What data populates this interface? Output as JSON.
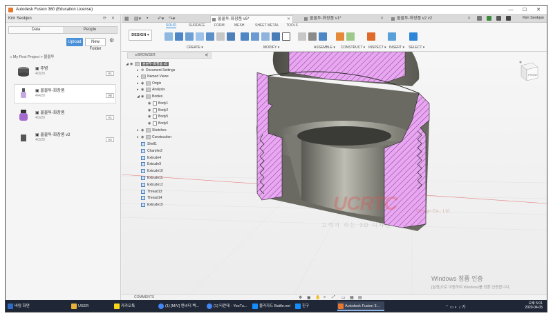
{
  "window": {
    "title": "Autodesk Fusion 360 (Education License)",
    "controls": [
      "—",
      "☐",
      "✕"
    ]
  },
  "data_panel": {
    "user": "Kim Seokjun",
    "tabs": [
      {
        "label": "Data",
        "active": true
      },
      {
        "label": "People",
        "active": false
      }
    ],
    "upload_label": "Upload",
    "new_folder_label": "New Folder",
    "breadcrumb": "My First Project  >  물물투",
    "files": [
      {
        "name": "주병",
        "date": "4/3/20",
        "version": "V1",
        "selected": false
      },
      {
        "name": "물물투-화장품",
        "date": "4/4/20",
        "version": "V8",
        "selected": true
      },
      {
        "name": "물물투-화장품",
        "date": "4/3/20",
        "version": "V1",
        "selected": false
      },
      {
        "name": "물물투-화장품 v2",
        "date": "4/3/20",
        "version": "V2",
        "selected": false
      }
    ]
  },
  "doc_tabs": [
    {
      "label": "물물투-화장품 v5*",
      "active": true
    },
    {
      "label": "물물투-화장품 v1*",
      "active": false
    },
    {
      "label": "물물투-화장품 v2 v2",
      "active": false
    }
  ],
  "doc_right_user": "Kim Seokjun",
  "toolbar": {
    "workspace_label": "DESIGN ▾",
    "tabs": [
      {
        "label": "SOLID",
        "active": true
      },
      {
        "label": "SURFACE",
        "active": false
      },
      {
        "label": "FORM",
        "active": false
      },
      {
        "label": "MESH",
        "active": false
      },
      {
        "label": "SHEET METAL",
        "active": false
      },
      {
        "label": "TOOLS",
        "active": false
      }
    ],
    "groups": [
      {
        "label": "CREATE ▾"
      },
      {
        "label": "MODIFY ▾"
      },
      {
        "label": "ASSEMBLE ▾"
      },
      {
        "label": "CONSTRUCT ▾"
      },
      {
        "label": "INSPECT ▾"
      },
      {
        "label": "INSERT ▾"
      },
      {
        "label": "SELECT ▾"
      }
    ]
  },
  "browser": {
    "header": "BROWSER",
    "root": "물물투-화장품 v5",
    "nodes": [
      "Document Settings",
      "Named Views",
      "Origin",
      "Analysis",
      "Bodies",
      "Body1",
      "Body2",
      "Body5",
      "Body6",
      "Sketches",
      "Construction"
    ],
    "features": [
      "Shell1",
      "Chamfer2",
      "Extrude4",
      "Extrude9",
      "Extrude10",
      "Extrude11",
      "Extrude12",
      "Thread13",
      "Thread14",
      "Extrude15"
    ]
  },
  "viewcube": {
    "label": "FRONT"
  },
  "watermark": {
    "logo": "UCRTC",
    "line1": "Design Co., Ltd",
    "line2": "고객과 쉬는 3D 디자인"
  },
  "activation": {
    "title": "Windows 정품 인증",
    "subtitle": "[설정]으로 이동하여 Windows를 정품 인증합니다."
  },
  "comments_label": "COMMENTS",
  "taskbar": {
    "items": [
      {
        "label": "바탕 화면",
        "color": "#2d6bc4"
      },
      {
        "label": "USER",
        "color": "#e8b23a"
      },
      {
        "label": "카카오톡",
        "color": "#f7d51d"
      },
      {
        "label": "(1) [M/V] 엔씨티 백...",
        "color": "#4285f4"
      },
      {
        "label": "(1) 타란테 - YouTu...",
        "color": "#4285f4"
      },
      {
        "label": "블리자드 Battle.net",
        "color": "#148eff"
      },
      {
        "label": "친구",
        "color": "#148eff"
      },
      {
        "label": "Autodesk Fusion 3...",
        "color": "#e8772e"
      }
    ],
    "time": "오후 5:01",
    "date": "2020-04-05"
  }
}
